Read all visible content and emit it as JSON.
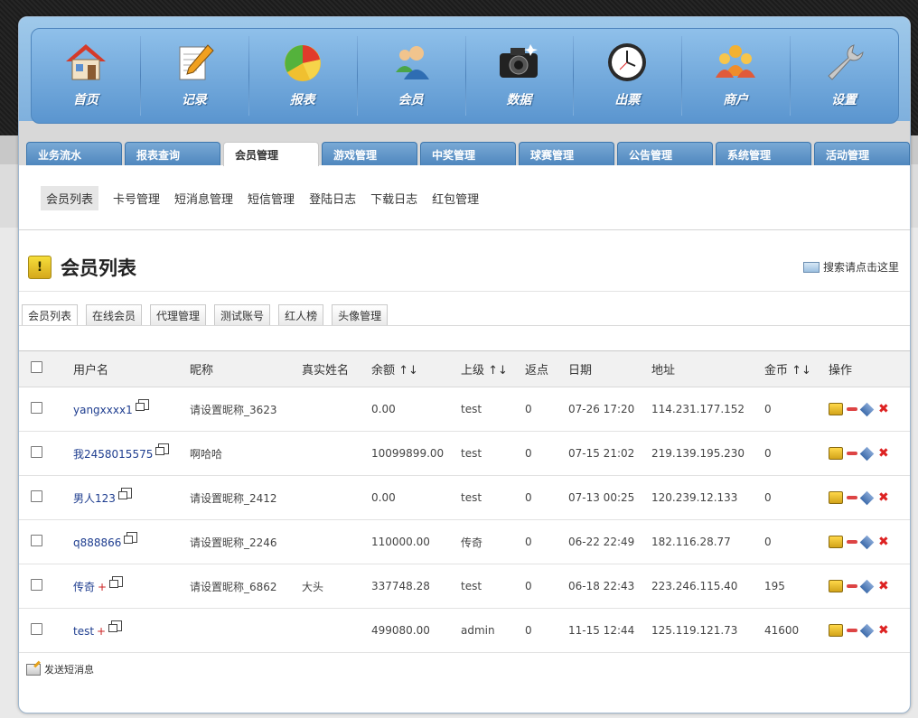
{
  "nav": {
    "items": [
      {
        "label": "首页",
        "icon": "house-icon"
      },
      {
        "label": "记录",
        "icon": "notepad-pencil-icon"
      },
      {
        "label": "报表",
        "icon": "pie-chart-icon"
      },
      {
        "label": "会员",
        "icon": "users-icon"
      },
      {
        "label": "数据",
        "icon": "camera-icon"
      },
      {
        "label": "出票",
        "icon": "clock-icon"
      },
      {
        "label": "商户",
        "icon": "merchant-people-icon"
      },
      {
        "label": "设置",
        "icon": "wrench-icon"
      }
    ]
  },
  "tabs": [
    "业务流水",
    "报表查询",
    "会员管理",
    "游戏管理",
    "中奖管理",
    "球赛管理",
    "公告管理",
    "系统管理",
    "活动管理"
  ],
  "active_tab": "会员管理",
  "subnav": [
    "会员列表",
    "卡号管理",
    "短消息管理",
    "短信管理",
    "登陆日志",
    "下载日志",
    "红包管理"
  ],
  "page": {
    "title": "会员列表",
    "search_link": "搜索请点击这里"
  },
  "subtabs": [
    "会员列表",
    "在线会员",
    "代理管理",
    "测试账号",
    "红人榜",
    "头像管理"
  ],
  "table": {
    "headers": [
      "用户名",
      "昵称",
      "真实姓名",
      "余额 ↑↓",
      "上级 ↑↓",
      "返点",
      "日期",
      "地址",
      "金币 ↑↓",
      "操作"
    ],
    "rows": [
      {
        "username": "yangxxxx1",
        "plus": "",
        "nickname": "请设置昵称_3623",
        "realname": "",
        "balance": "0.00",
        "parent": "test",
        "rebate": "0",
        "date": "07-26 17:20",
        "address": "114.231.177.152",
        "coins": "0"
      },
      {
        "username": "我2458015575",
        "plus": "",
        "nickname": "啊哈哈",
        "realname": "",
        "balance": "10099899.00",
        "parent": "test",
        "rebate": "0",
        "date": "07-15 21:02",
        "address": "219.139.195.230",
        "coins": "0"
      },
      {
        "username": "男人123",
        "plus": "",
        "nickname": "请设置昵称_2412",
        "realname": "",
        "balance": "0.00",
        "parent": "test",
        "rebate": "0",
        "date": "07-13 00:25",
        "address": "120.239.12.133",
        "coins": "0"
      },
      {
        "username": "q888866",
        "plus": "",
        "nickname": "请设置昵称_2246",
        "realname": "",
        "balance": "110000.00",
        "parent": "传奇",
        "rebate": "0",
        "date": "06-22 22:49",
        "address": "182.116.28.77",
        "coins": "0"
      },
      {
        "username": "传奇",
        "plus": "+",
        "nickname": "请设置昵称_6862",
        "realname": "大头",
        "balance": "337748.28",
        "parent": "test",
        "rebate": "0",
        "date": "06-18 22:43",
        "address": "223.246.115.40",
        "coins": "195"
      },
      {
        "username": "test",
        "plus": "+",
        "nickname": "",
        "realname": "",
        "balance": "499080.00",
        "parent": "admin",
        "rebate": "0",
        "date": "11-15 12:44",
        "address": "125.119.121.73",
        "coins": "41600"
      }
    ]
  },
  "footer": {
    "send_message": "发送短消息"
  }
}
